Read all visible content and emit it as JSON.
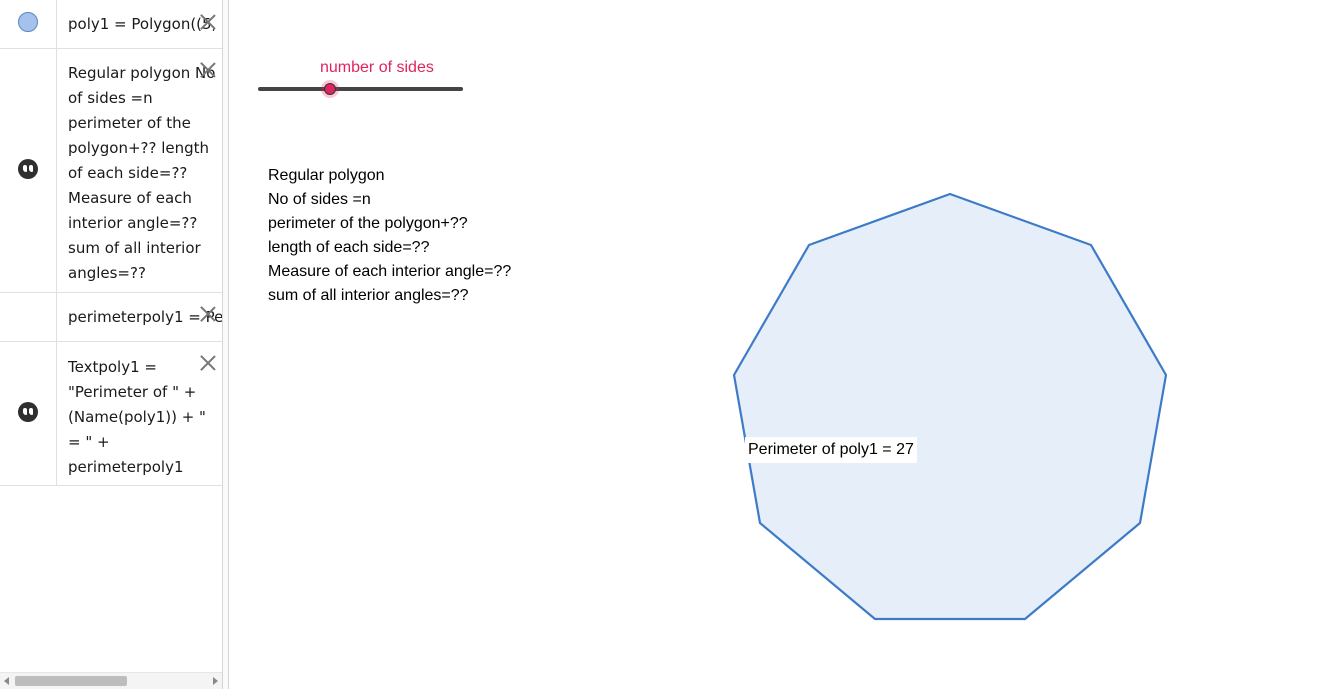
{
  "algebra": {
    "rows": [
      {
        "icon": "shape-color-marble",
        "text": "poly1 = Polygon((5,"
      },
      {
        "icon": "quote-icon",
        "text": "Regular polygon No\nof sides =n\nperimeter of the\npolygon+?? length\nof each side=??\nMeasure of each\ninterior angle=??\nsum of all interior\nangles=??"
      },
      {
        "icon": "",
        "text": "perimeterpoly1 = Pe"
      },
      {
        "icon": "quote-icon",
        "text": "Textpoly1 =\n\"Perimeter of \" +\n(Name(poly1)) + \"\n= \" +\nperimeterpoly1"
      }
    ]
  },
  "graphics": {
    "slider": {
      "label": "number of sides",
      "value_fraction": 0.35
    },
    "text_lines": [
      "Regular polygon",
      "No of sides =n",
      "perimeter of the polygon+??",
      "length of each side=??",
      "Measure of each interior angle=??",
      "sum of all interior angles=??"
    ],
    "polygon": {
      "sides": 9,
      "fill": "#e6eff9",
      "stroke": "#3d7bc8"
    },
    "perimeter_label": "Perimeter of poly1 = 27"
  },
  "colors": {
    "accent": "#e0245e",
    "polygon_stroke": "#3d7bc8"
  }
}
